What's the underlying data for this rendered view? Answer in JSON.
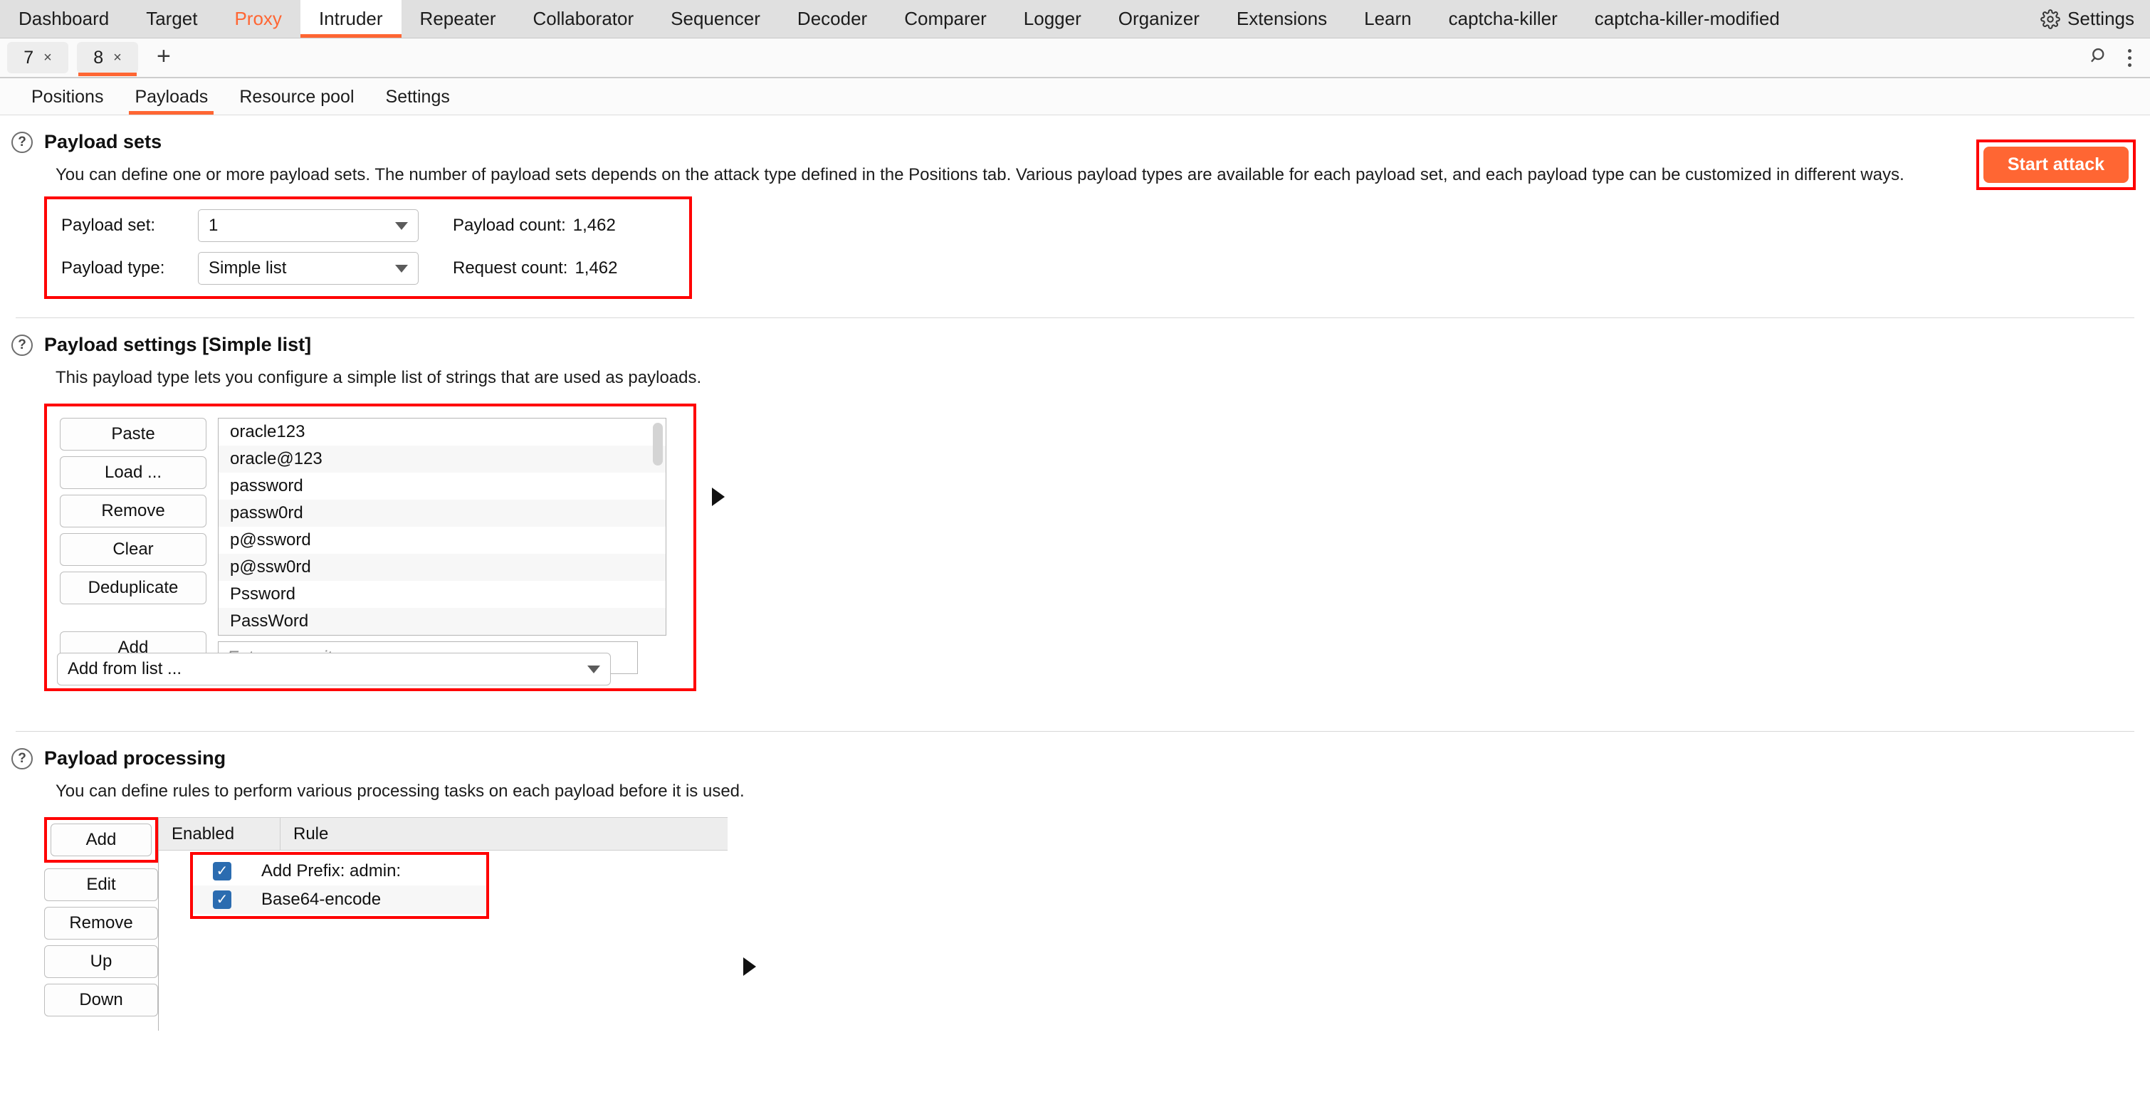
{
  "main_tabs": [
    {
      "label": "Dashboard",
      "state": "normal"
    },
    {
      "label": "Target",
      "state": "normal"
    },
    {
      "label": "Proxy",
      "state": "highlight"
    },
    {
      "label": "Intruder",
      "state": "active"
    },
    {
      "label": "Repeater",
      "state": "normal"
    },
    {
      "label": "Collaborator",
      "state": "normal"
    },
    {
      "label": "Sequencer",
      "state": "normal"
    },
    {
      "label": "Decoder",
      "state": "normal"
    },
    {
      "label": "Comparer",
      "state": "normal"
    },
    {
      "label": "Logger",
      "state": "normal"
    },
    {
      "label": "Organizer",
      "state": "normal"
    },
    {
      "label": "Extensions",
      "state": "normal"
    },
    {
      "label": "Learn",
      "state": "normal"
    },
    {
      "label": "captcha-killer",
      "state": "normal"
    },
    {
      "label": "captcha-killer-modified",
      "state": "normal"
    }
  ],
  "settings_button": {
    "label": "Settings",
    "icon": "gear-icon"
  },
  "attack_tabs": [
    {
      "label": "7",
      "close": "×",
      "active": false
    },
    {
      "label": "8",
      "close": "×",
      "active": true
    }
  ],
  "new_tab_button": {
    "label": "+"
  },
  "tabrow_right": {
    "search_icon": "search-icon",
    "menu_icon": "kebab-menu-icon"
  },
  "sub_tabs": [
    {
      "label": "Positions",
      "active": false
    },
    {
      "label": "Payloads",
      "active": true
    },
    {
      "label": "Resource pool",
      "active": false
    },
    {
      "label": "Settings",
      "active": false
    }
  ],
  "payload_sets": {
    "title": "Payload sets",
    "help_icon": "?",
    "description": "You can define one or more payload sets. The number of payload sets depends on the attack type defined in the Positions tab. Various payload types are available for each payload set, and each payload type can be customized in different ways.",
    "payload_set_label": "Payload set:",
    "payload_set_value": "1",
    "payload_type_label": "Payload type:",
    "payload_type_value": "Simple list",
    "payload_count_label": "Payload count:",
    "payload_count_value": "1,462",
    "request_count_label": "Request count:",
    "request_count_value": "1,462",
    "start_attack_label": "Start attack"
  },
  "payload_settings": {
    "title": "Payload settings [Simple list]",
    "help_icon": "?",
    "description": "This payload type lets you configure a simple list of strings that are used as payloads.",
    "buttons": [
      {
        "label": "Paste"
      },
      {
        "label": "Load ..."
      },
      {
        "label": "Remove"
      },
      {
        "label": "Clear"
      },
      {
        "label": "Deduplicate"
      },
      {
        "label": "Add"
      }
    ],
    "add_from_list_label": "Add from list ...",
    "new_item_placeholder": "Enter a new item",
    "items": [
      "oracle123",
      "oracle@123",
      "password",
      "passw0rd",
      "p@ssword",
      "p@ssw0rd",
      "Pssword",
      "PassWord"
    ]
  },
  "payload_processing": {
    "title": "Payload processing",
    "help_icon": "?",
    "description": "You can define rules to perform various processing tasks on each payload before it is used.",
    "buttons": [
      {
        "label": "Add"
      },
      {
        "label": "Edit"
      },
      {
        "label": "Remove"
      },
      {
        "label": "Up"
      },
      {
        "label": "Down"
      }
    ],
    "columns": [
      "Enabled",
      "Rule"
    ],
    "rules": [
      {
        "enabled": true,
        "check": "✓",
        "rule": "Add Prefix: admin:"
      },
      {
        "enabled": true,
        "check": "✓",
        "rule": "Base64-encode"
      }
    ]
  },
  "colors": {
    "accent": "#ff6633",
    "annotation": "#ff0000",
    "checkbox": "#2b6cb0"
  }
}
